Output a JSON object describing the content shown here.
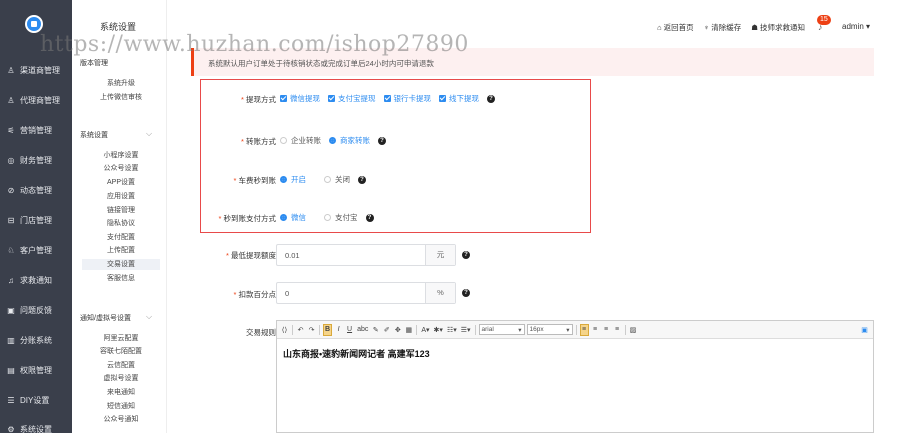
{
  "nav": {
    "items": [
      {
        "label": "渠道商管理",
        "icon": "user-icon"
      },
      {
        "label": "代理商管理",
        "icon": "agent-icon"
      },
      {
        "label": "营销管理",
        "icon": "marketing-icon"
      },
      {
        "label": "财务管理",
        "icon": "finance-icon"
      },
      {
        "label": "动态管理",
        "icon": "feed-icon"
      },
      {
        "label": "门店管理",
        "icon": "store-icon"
      },
      {
        "label": "客户管理",
        "icon": "customers-icon"
      },
      {
        "label": "求救通知",
        "icon": "bell-icon"
      },
      {
        "label": "问题反馈",
        "icon": "feedback-icon"
      },
      {
        "label": "分账系统",
        "icon": "split-icon"
      },
      {
        "label": "权限管理",
        "icon": "permission-icon"
      },
      {
        "label": "DIY设置",
        "icon": "diy-icon"
      },
      {
        "label": "系统设置",
        "icon": "settings-icon"
      }
    ]
  },
  "sub": {
    "title": "系统设置",
    "g1": {
      "title": "版本管理",
      "items": [
        "系统升级",
        "上传微信审核"
      ]
    },
    "g2": {
      "title": "系统设置",
      "items": [
        "小程序设置",
        "公众号设置",
        "APP设置",
        "应用设置",
        "链接管理",
        "隐私协议",
        "支付配置",
        "上传配置",
        "交易设置",
        "客服信息"
      ],
      "active": "交易设置"
    },
    "g3": {
      "title": "通知/虚拟号设置",
      "items": [
        "阿里云配置",
        "容联七陌配置",
        "云信配置",
        "虚拟号设置",
        "来电通知",
        "短信通知",
        "公众号通知"
      ]
    }
  },
  "header": {
    "home": "返回首页",
    "clear": "清除缓存",
    "notify": "技师求救通知",
    "badge": "15",
    "user": "admin ▾"
  },
  "watermark": "https://www.huzhan.com/ishop27890",
  "notice": "系统默认用户订单处于待核销状态或完成订单后24小时内可申请退款",
  "form": {
    "withdraw": {
      "label": "提现方式",
      "options": [
        "微信提现",
        "支付宝提现",
        "银行卡提现",
        "线下提现"
      ]
    },
    "transfer": {
      "label": "转账方式",
      "options": [
        "企业转账",
        "商家转账"
      ],
      "selected": "商家转账"
    },
    "carfee": {
      "label": "车费秒到账",
      "options": [
        "开启",
        "关闭"
      ],
      "selected": "开启"
    },
    "instant": {
      "label": "秒到账支付方式",
      "options": [
        "微信",
        "支付宝"
      ],
      "selected": "微信"
    },
    "minwd": {
      "label": "最低提现额度",
      "value": "0.01",
      "unit": "元"
    },
    "fee": {
      "label": "扣款百分点",
      "value": "0",
      "unit": "%"
    },
    "rules": {
      "label": "交易规则"
    }
  },
  "editor": {
    "font": "arial",
    "size": "16px",
    "content": "山东商报•速豹新闻网记者 高建军123"
  }
}
